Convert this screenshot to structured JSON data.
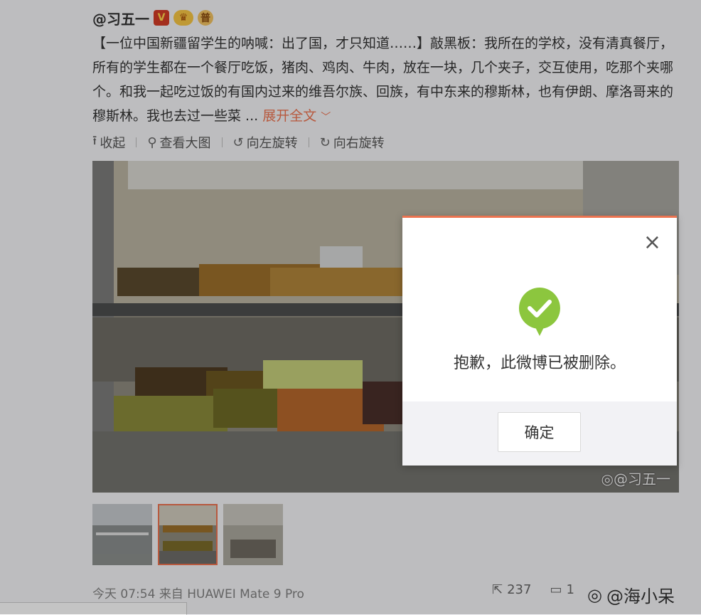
{
  "post": {
    "username": "@习五一",
    "badges": {
      "verified": "V",
      "crown": "♛",
      "level": "普"
    },
    "text_intro": "【一位中国新疆留学生的呐喊：出了国，才只知道……】敲黑板：我所在的学校，没有清真餐厅，所有的学生都在一个餐厅吃饭，猪肉、鸡肉、牛肉，放在一块，几个夹子，交互使用，吃那个夹哪个。和我一起吃过饭的有国内过来的维吾尔族、回族，有中东来的穆斯林，也有伊朗、摩洛哥来的穆斯林。我也去过一些菜 ... ",
    "expand_label": "展开全文",
    "toolbar": {
      "collapse": "收起",
      "view_large": "查看大图",
      "rotate_left": "向左旋转",
      "rotate_right": "向右旋转"
    },
    "image_watermark": "@习五一",
    "meta": {
      "timestamp": "今天 07:54",
      "source_prefix": "来自",
      "device": "HUAWEI Mate 9 Pro",
      "forward_count": "237",
      "comment_count_partial": "1"
    },
    "corner_watermark": "@海小呆"
  },
  "dialog": {
    "message": "抱歉，此微博已被删除。",
    "confirm_label": "确定",
    "close_glyph": "×"
  },
  "colors": {
    "accent": "#eb7350",
    "success_green": "#8cc63e",
    "text": "#333333",
    "muted": "#808080"
  }
}
